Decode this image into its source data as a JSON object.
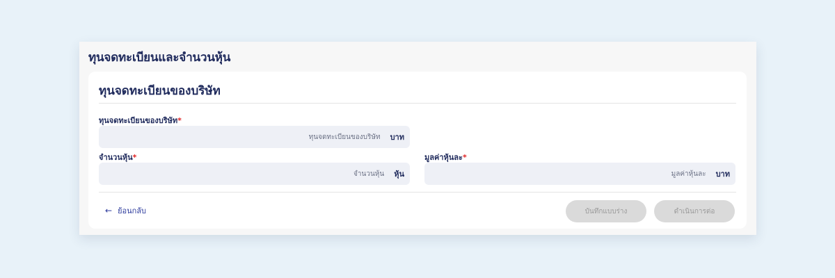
{
  "panel": {
    "title": "ทุนจดทะเบียนและจำนวนหุ้น"
  },
  "card": {
    "title": "ทุนจดทะเบียนของบริษัท",
    "fields": {
      "capital": {
        "label": "ทุนจดทะเบียนของบริษัท",
        "required_mark": "*",
        "placeholder": "ทุนจดทะเบียนของบริษัท",
        "value": "",
        "unit": "บาท"
      },
      "shares": {
        "label": "จำนวนหุ้น",
        "required_mark": "*",
        "placeholder": "จำนวนหุ้น",
        "value": "",
        "unit": "หุ้น"
      },
      "par_value": {
        "label": "มูลค่าหุ้นละ",
        "required_mark": "*",
        "placeholder": "มูลค่าหุ้นละ",
        "value": "",
        "unit": "บาท"
      }
    }
  },
  "footer": {
    "back_label": "ย้อนกลับ",
    "back_icon": "arrow-left-icon",
    "save_draft_label": "บันทึกแบบร่าง",
    "continue_label": "ดำเนินการต่อ",
    "buttons_disabled": true
  },
  "colors": {
    "background": "#e8f2f9",
    "text_primary": "#1f2a5c",
    "link": "#2c3a9c",
    "required": "#e02424",
    "input_bg": "#eef0f6",
    "disabled_button": "#dadada"
  }
}
